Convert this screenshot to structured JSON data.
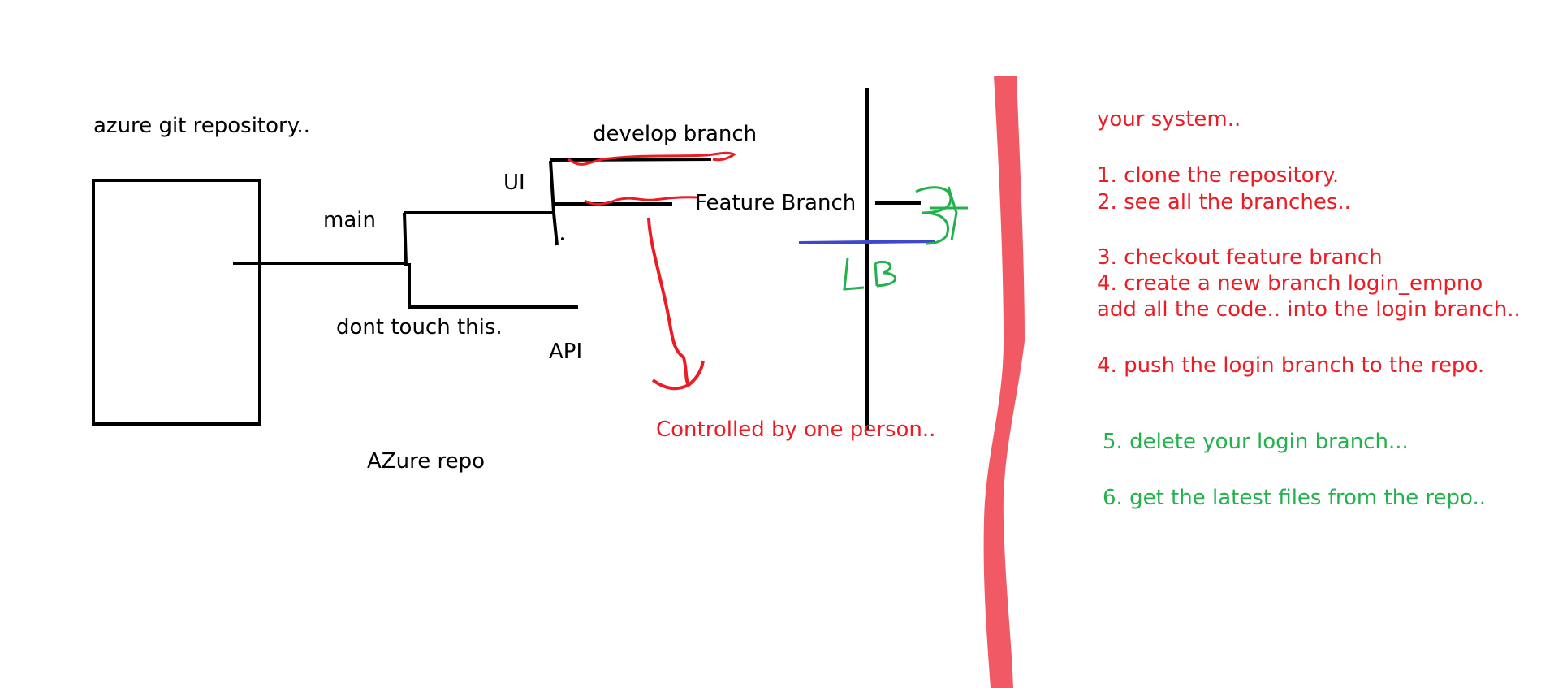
{
  "colors": {
    "ink": "#000000",
    "red": "#ed1c24",
    "green": "#22b14c",
    "blue": "#3f48cc",
    "divider": "#f15a64"
  },
  "labels": {
    "repo_title": "azure git repository..",
    "main": "main",
    "ui": "UI",
    "develop": "develop branch",
    "feature": "Feature Branch",
    "dont_touch": "dont touch this.",
    "api": "API",
    "azure_repo": "AZure repo",
    "controlled": "Controlled by one person..",
    "lb": "LB"
  },
  "steps": {
    "title": "your system..",
    "s1": "1. clone the repository.",
    "s2": "2. see all the branches..",
    "s3": "3. checkout feature branch",
    "s4": "4. create a new branch login_empno",
    "s4b": "add all the code.. into the login branch..",
    "s5": "4. push the login branch to the repo.",
    "s6": "5. delete your login branch...",
    "s7": "6. get the latest files from the repo.."
  }
}
